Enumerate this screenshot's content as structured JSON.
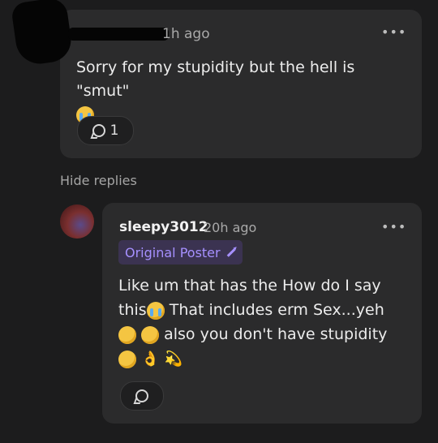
{
  "top_comment": {
    "timestamp": "1h ago",
    "text": "Sorry for my stupidity but the hell is \"smut\"",
    "emoji": "😭",
    "reply_count": "1",
    "more_icon": "more-horizontal-icon"
  },
  "hide_replies_label": "Hide replies",
  "reply": {
    "username": "sleepy3012",
    "timestamp": "20h ago",
    "badge": "Original Poster",
    "line1": "Like um that has the How do I say",
    "line2a": "this",
    "line2b": " That includes erm Sex...yeh",
    "line3b": " also you don't have stupidity",
    "emojis": [
      "😭",
      "😐",
      "😅",
      "😊",
      "👌",
      "💫"
    ]
  },
  "colors": {
    "background": "#1c1c1d",
    "card": "#2b2b2c",
    "badge_bg": "#3b3351",
    "badge_text": "#a690ff"
  }
}
